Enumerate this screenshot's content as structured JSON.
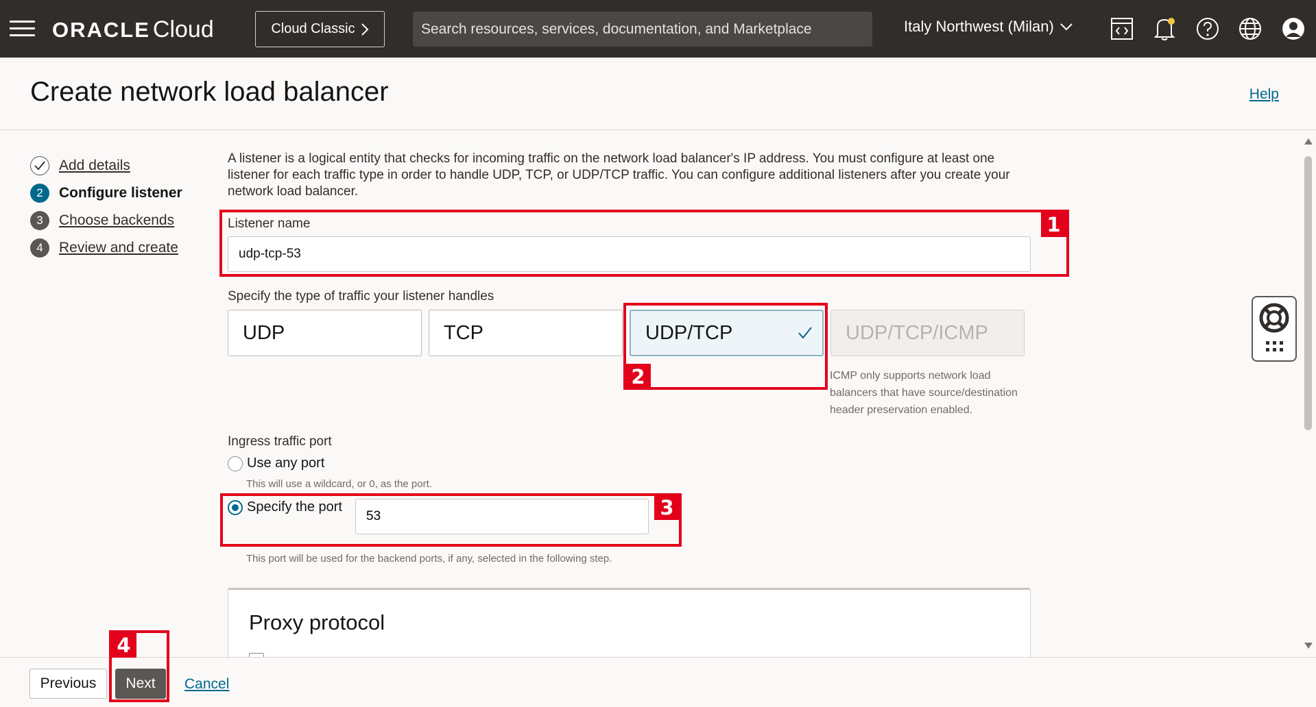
{
  "topbar": {
    "brand": "ORACLE",
    "product": "Cloud",
    "classic_button": "Cloud Classic",
    "search_placeholder": "Search resources, services, documentation, and Marketplace",
    "region": "Italy Northwest (Milan)"
  },
  "page": {
    "title": "Create network load balancer",
    "help_link": "Help"
  },
  "steps": [
    {
      "number": "1",
      "label": "Add details",
      "state": "done"
    },
    {
      "number": "2",
      "label": "Configure listener",
      "state": "current"
    },
    {
      "number": "3",
      "label": "Choose backends",
      "state": "todo"
    },
    {
      "number": "4",
      "label": "Review and create",
      "state": "todo"
    }
  ],
  "form": {
    "intro": "A listener is a logical entity that checks for incoming traffic on the network load balancer's IP address. You must configure at least one listener for each traffic type in order to handle UDP, TCP, or UDP/TCP traffic. You can configure additional listeners after you create your network load balancer.",
    "listener_name_label": "Listener name",
    "listener_name_value": "udp-tcp-53",
    "traffic_type_label": "Specify the type of traffic your listener handles",
    "traffic_types": [
      {
        "label": "UDP",
        "state": "default"
      },
      {
        "label": "TCP",
        "state": "default"
      },
      {
        "label": "UDP/TCP",
        "state": "selected"
      },
      {
        "label": "UDP/TCP/ICMP",
        "state": "disabled"
      }
    ],
    "icmp_note": "ICMP only supports network load balancers that have source/destination header preservation enabled.",
    "ingress_label": "Ingress traffic port",
    "any_port_label": "Use any port",
    "any_port_help": "This will use a wildcard, or 0, as the port.",
    "specify_port_label": "Specify the port",
    "port_value": "53",
    "port_help": "This port will be used for the backend ports, if any, selected in the following step.",
    "proxy_title": "Proxy protocol"
  },
  "footer": {
    "previous": "Previous",
    "next": "Next",
    "cancel": "Cancel"
  },
  "annotations": [
    "1",
    "2",
    "3",
    "4"
  ],
  "colors": {
    "topbar_bg": "#312d2a",
    "accent": "#00688c",
    "annotation": "#e3001b",
    "next_button": "#5b5753"
  }
}
